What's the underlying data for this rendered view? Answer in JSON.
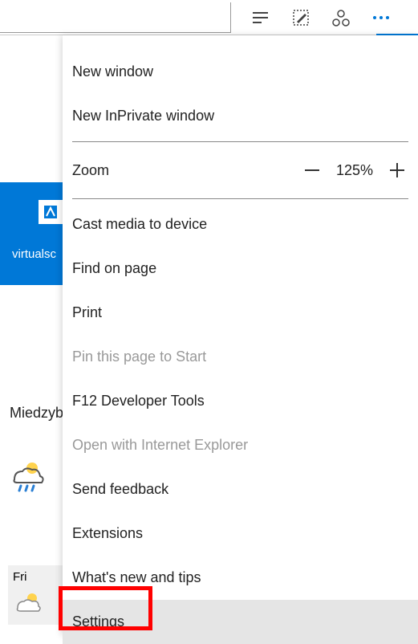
{
  "toolbar": {
    "reading_icon": "reading-view",
    "notes_icon": "web-note",
    "share_icon": "share",
    "more_icon": "more"
  },
  "background": {
    "tile_label": "virtualsc",
    "partial_text": "Miedzyb",
    "day_label": "Fri"
  },
  "menu": {
    "new_window": "New window",
    "new_inprivate": "New InPrivate window",
    "zoom_label": "Zoom",
    "zoom_value": "125%",
    "cast": "Cast media to device",
    "find": "Find on page",
    "print": "Print",
    "pin": "Pin this page to Start",
    "devtools": "F12 Developer Tools",
    "open_ie": "Open with Internet Explorer",
    "feedback": "Send feedback",
    "extensions": "Extensions",
    "whatsnew": "What's new and tips",
    "settings": "Settings"
  }
}
